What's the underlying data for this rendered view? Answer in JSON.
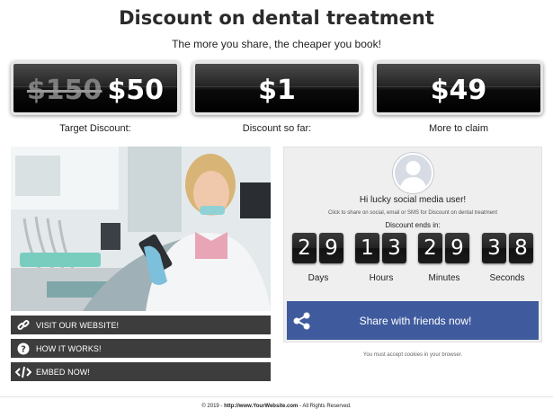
{
  "header": {
    "title": "Discount on dental treatment",
    "subtitle": "The more you share, the cheaper you book!"
  },
  "price_boxes": [
    {
      "old_price": "$150",
      "value": "$50",
      "label": "Target Discount:"
    },
    {
      "value": "$1",
      "label": "Discount so far:"
    },
    {
      "value": "$49",
      "label": "More to claim"
    }
  ],
  "links": [
    {
      "label": "VISIT OUR WEBSITE!",
      "icon": "link-icon"
    },
    {
      "label": "HOW IT WORKS!",
      "icon": "question-icon"
    },
    {
      "label": "EMBED NOW!",
      "icon": "code-icon"
    }
  ],
  "share_panel": {
    "greeting": "Hi lucky social media user!",
    "hint": "Click to share on social, email or SMS for Discount on dental treatment",
    "countdown_label": "Discount ends in:",
    "countdown": {
      "days": [
        "2",
        "9"
      ],
      "hours": [
        "1",
        "3"
      ],
      "minutes": [
        "2",
        "9"
      ],
      "seconds": [
        "3",
        "8"
      ]
    },
    "units": {
      "days": "Days",
      "hours": "Hours",
      "minutes": "Minutes",
      "seconds": "Seconds"
    },
    "share_button": "Share with friends now!",
    "cookie_note": "You must accept cookies in your browser."
  },
  "footer": {
    "prefix": "© 2019 - ",
    "link": "http://www.YourWebsite.com",
    "suffix": " - All Rights Reserved."
  },
  "colors": {
    "share_button": "#3f5b9e",
    "link_buttons": "#3d3d3d",
    "panel_background": "#efefef"
  }
}
